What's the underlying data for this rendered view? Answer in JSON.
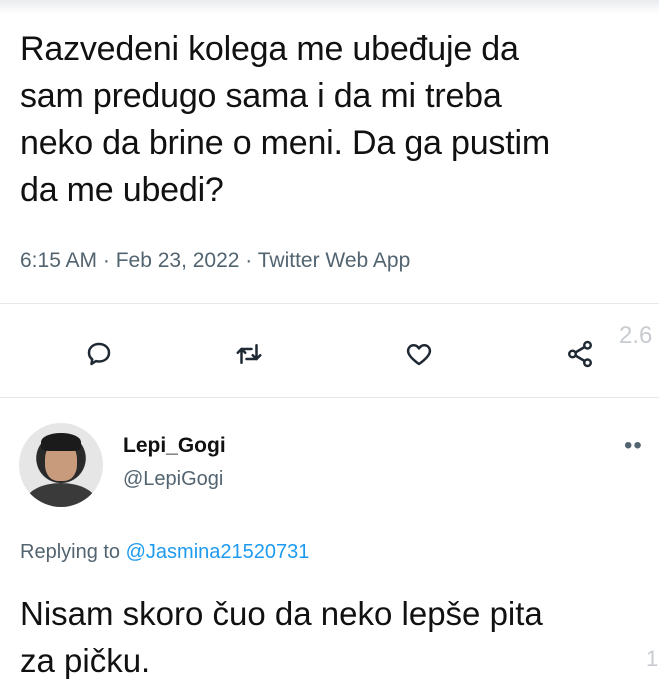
{
  "tweet": {
    "text": "Razvedeni kolega me ubeđuje da\nsam predugo sama i da mi treba\nneko da brine o meni. Da ga pustim\nda me ubedi?",
    "meta": "6:15 AM · Feb 23, 2022 · Twitter Web App",
    "count_partial": "2.6"
  },
  "actions": {
    "reply_icon": "comment-icon",
    "retweet_icon": "retweet-icon",
    "like_icon": "heart-icon",
    "share_icon": "share-icon"
  },
  "reply": {
    "name": "Lepi_Gogi",
    "handle": "@LepiGogi",
    "more": "••",
    "replying_prefix": "Replying to",
    "replying_to": "@Jasmina21520731",
    "text": "Nisam skoro čuo da neko lepše pita\nza pičku.",
    "corner": "1"
  },
  "colors": {
    "text": "#0f1419",
    "muted": "#536471",
    "link": "#1d9bf0",
    "icon": "#536471"
  }
}
